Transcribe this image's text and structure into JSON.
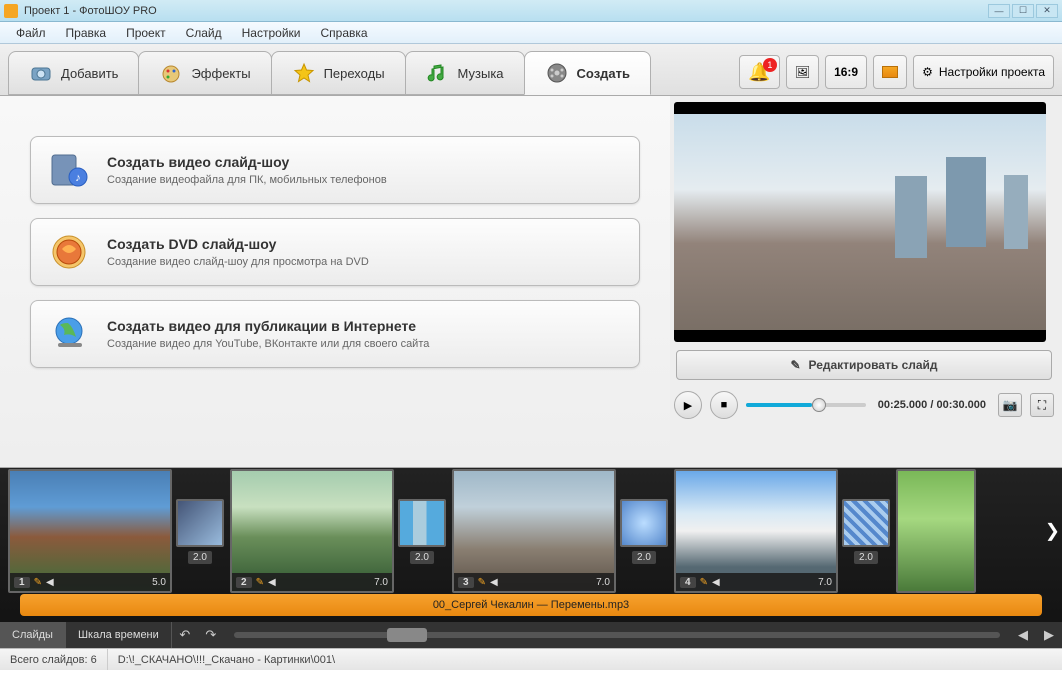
{
  "window": {
    "title": "Проект 1 - ФотоШОУ PRO"
  },
  "menu": {
    "items": [
      "Файл",
      "Правка",
      "Проект",
      "Слайд",
      "Настройки",
      "Справка"
    ]
  },
  "toolbar": {
    "tabs": [
      {
        "label": "Добавить",
        "icon": "camera"
      },
      {
        "label": "Эффекты",
        "icon": "palette"
      },
      {
        "label": "Переходы",
        "icon": "star"
      },
      {
        "label": "Музыка",
        "icon": "music"
      },
      {
        "label": "Создать",
        "icon": "film",
        "active": true
      }
    ],
    "active_index": 4,
    "notification_count": "1",
    "aspect_label": "16:9",
    "settings_label": "Настройки проекта"
  },
  "create_options": [
    {
      "title": "Создать видео слайд-шоу",
      "desc": "Создание видеофайла для ПК, мобильных телефонов",
      "icon": "video"
    },
    {
      "title": "Создать DVD слайд-шоу",
      "desc": "Создание видео слайд-шоу для просмотра на DVD",
      "icon": "dvd"
    },
    {
      "title": "Создать видео для публикации в Интернете",
      "desc": "Создание видео для YouTube, ВКонтакте или для своего сайта",
      "icon": "globe"
    }
  ],
  "preview": {
    "edit_label": "Редактировать слайд",
    "current_time": "00:25.000",
    "total_time": "00:30.000",
    "progress_pct": 55
  },
  "timeline": {
    "slides": [
      {
        "number": "1",
        "duration": "5.0",
        "transition_duration": "2.0"
      },
      {
        "number": "2",
        "duration": "7.0",
        "transition_duration": "2.0"
      },
      {
        "number": "3",
        "duration": "7.0",
        "transition_duration": "2.0"
      },
      {
        "number": "4",
        "duration": "7.0",
        "transition_duration": "2.0"
      }
    ],
    "audio_track": "00_Сергей Чекалин — Перемены.mp3",
    "tabs": {
      "slides": "Слайды",
      "timeline": "Шкала времени"
    },
    "active_tab": "slides"
  },
  "status": {
    "total_slides_label": "Всего слайдов:",
    "total_slides": "6",
    "path": "D:\\!_СКАЧАНО\\!!!_Скачано - Картинки\\001\\"
  }
}
